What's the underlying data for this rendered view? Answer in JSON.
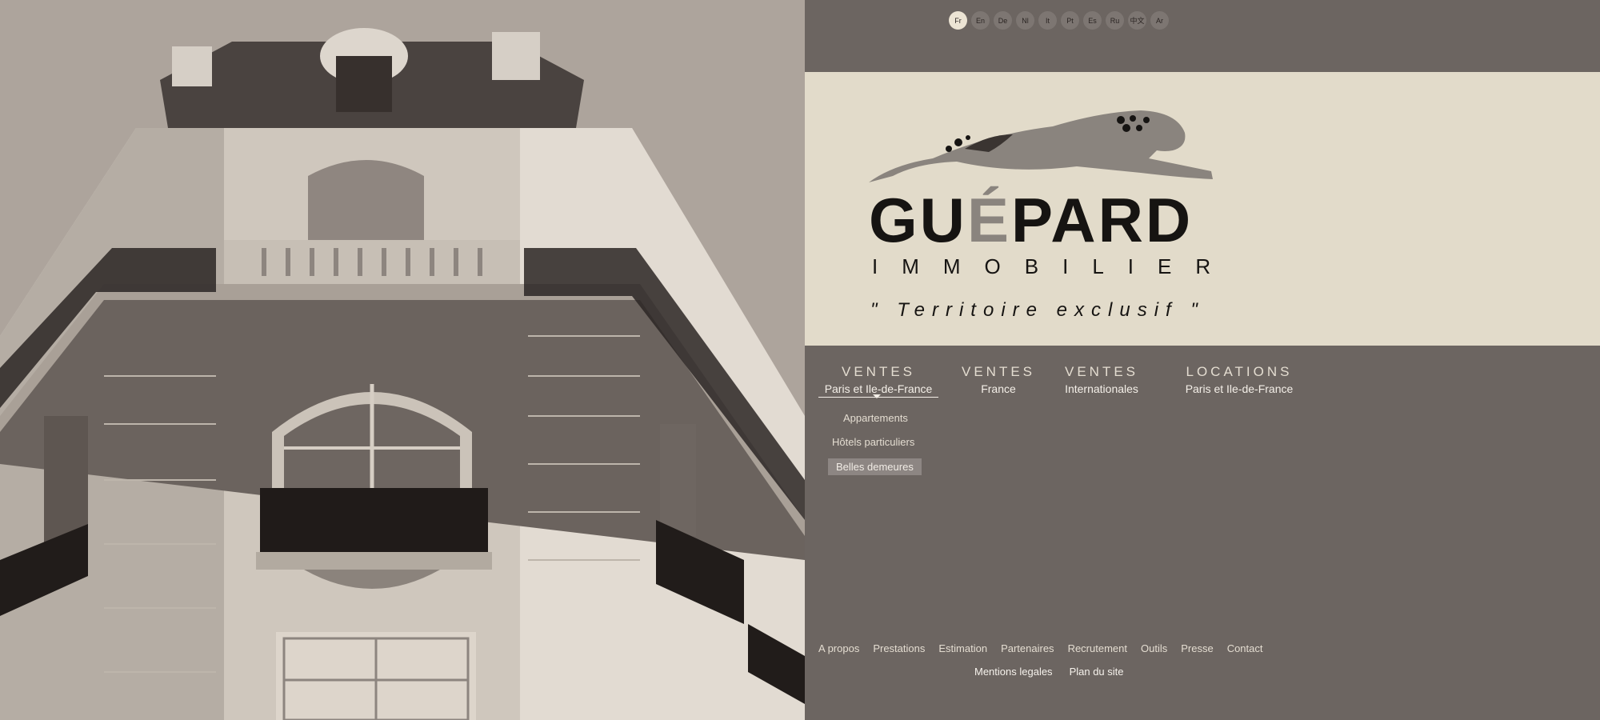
{
  "languages": [
    {
      "code": "Fr",
      "active": true
    },
    {
      "code": "En"
    },
    {
      "code": "De"
    },
    {
      "code": "Nl"
    },
    {
      "code": "It"
    },
    {
      "code": "Pt"
    },
    {
      "code": "Es"
    },
    {
      "code": "Ru"
    },
    {
      "code": "中文"
    },
    {
      "code": "Ar"
    }
  ],
  "brand": {
    "name_part1": "GU",
    "name_accent": "É",
    "name_part2": "PARD",
    "subtitle": "IMMOBILIER",
    "tagline": "\" Territoire exclusif \"",
    "logo_icon": "cheetah-icon"
  },
  "nav": [
    {
      "title": "VENTES",
      "sub": "Paris et Ile-de-France",
      "active": true
    },
    {
      "title": "VENTES",
      "sub": "France"
    },
    {
      "title": "VENTES",
      "sub": "Internationales"
    },
    {
      "title": "LOCATIONS",
      "sub": "Paris et Ile-de-France"
    }
  ],
  "submenu": [
    "Appartements",
    "Hôtels particuliers",
    "Belles demeures"
  ],
  "footer": {
    "links": [
      "A propos",
      "Prestations",
      "Estimation",
      "Partenaires",
      "Recrutement",
      "Outils",
      "Presse",
      "Contact"
    ],
    "legal": [
      "Mentions legales",
      "Plan du site"
    ]
  },
  "colors": {
    "panel_bg": "#6c6561",
    "hero_bg": "#e2dbca",
    "text_dark": "#161412",
    "accent_grey": "#8a847e"
  }
}
